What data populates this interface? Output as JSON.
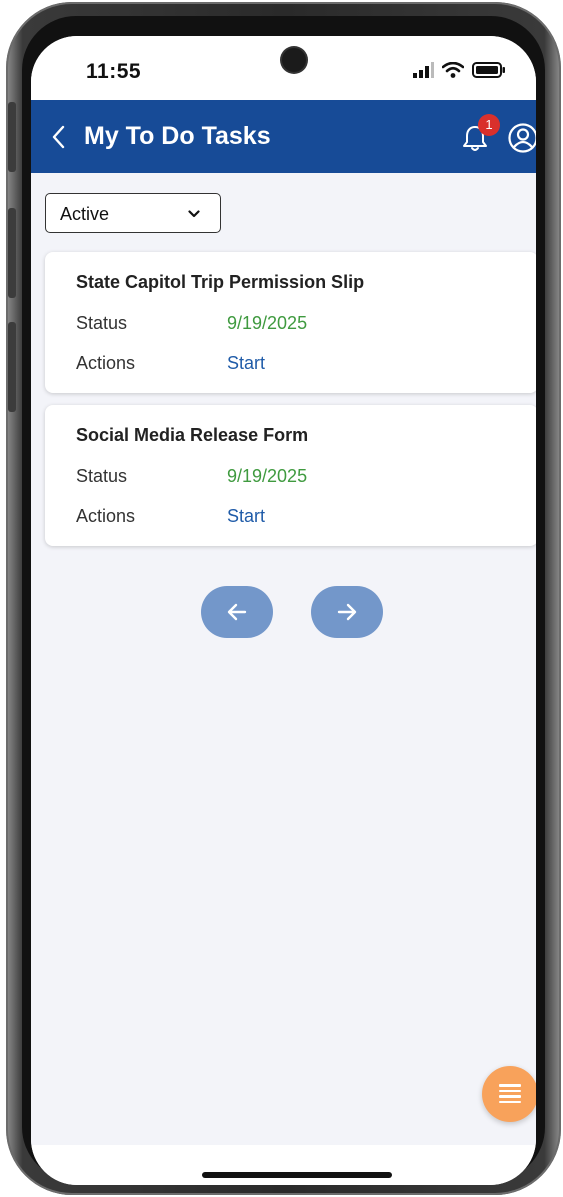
{
  "status_bar": {
    "time": "11:55"
  },
  "header": {
    "title": "My To Do Tasks",
    "notification_count": "1"
  },
  "filter": {
    "selected": "Active"
  },
  "tasks": [
    {
      "title": "State Capitol Trip Permission Slip",
      "status_label": "Status",
      "status_value": "9/19/2025",
      "actions_label": "Actions",
      "action": "Start"
    },
    {
      "title": "Social Media Release Form",
      "status_label": "Status",
      "status_value": "9/19/2025",
      "actions_label": "Actions",
      "action": "Start"
    }
  ],
  "pagination": {
    "prev_icon": "arrow-left-icon",
    "next_icon": "arrow-right-icon"
  },
  "fab": {
    "icon": "menu-icon"
  },
  "colors": {
    "header_bg": "#174b97",
    "status_green": "#3f9a3f",
    "link_blue": "#1f5ba8",
    "pager_bg": "#7397ca",
    "fab_bg": "#f8a25b",
    "badge_red": "#d9302c"
  }
}
